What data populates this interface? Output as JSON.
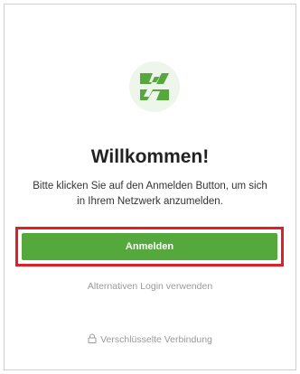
{
  "welcome": {
    "title": "Willkommen!",
    "message": "Bitte klicken Sie auf den Anmelden Button, um sich in Ihrem Netzwerk anzumelden."
  },
  "login_button_label": "Anmelden",
  "alt_login_label": "Alternativen Login verwenden",
  "secure_connection_label": "Verschlüsselte Verbindung",
  "icons": {
    "logo": "app-logo-icon",
    "lock": "lock-icon"
  },
  "colors": {
    "brand": "#55a83c",
    "highlight": "#e01f26",
    "muted": "#9a9a9a"
  }
}
